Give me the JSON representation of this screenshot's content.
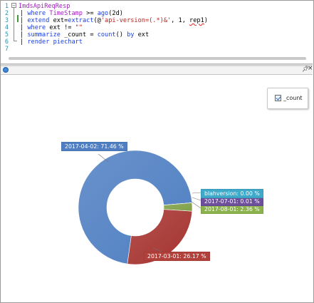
{
  "editor": {
    "lines": [
      {
        "num": "1",
        "segments": [
          {
            "t": "ImdsApiReqResp",
            "c": "purple"
          }
        ]
      },
      {
        "num": "2",
        "segments": [
          {
            "t": "| ",
            "c": "plain"
          },
          {
            "t": "where",
            "c": "blue"
          },
          {
            "t": " TimeStamp ",
            "c": "purple"
          },
          {
            "t": ">= ",
            "c": "plain"
          },
          {
            "t": "ago",
            "c": "blue"
          },
          {
            "t": "(2d)",
            "c": "plain"
          }
        ]
      },
      {
        "num": "3",
        "segments": [
          {
            "t": "| ",
            "c": "plain"
          },
          {
            "t": "extend",
            "c": "blue"
          },
          {
            "t": " ext=",
            "c": "plain"
          },
          {
            "t": "extract",
            "c": "blue"
          },
          {
            "t": "(@",
            "c": "plain"
          },
          {
            "t": "'api-version=(.*)&'",
            "c": "red"
          },
          {
            "t": ", 1, ",
            "c": "plain"
          },
          {
            "t": "rep1",
            "c": "plain",
            "squiggle": true
          },
          {
            "t": ")",
            "c": "plain"
          }
        ]
      },
      {
        "num": "4",
        "segments": [
          {
            "t": "| ",
            "c": "plain"
          },
          {
            "t": "where",
            "c": "blue"
          },
          {
            "t": " ext != ",
            "c": "plain"
          },
          {
            "t": "\"\"",
            "c": "red"
          }
        ]
      },
      {
        "num": "5",
        "segments": [
          {
            "t": "| ",
            "c": "plain"
          },
          {
            "t": "summarize",
            "c": "blue"
          },
          {
            "t": " _count = ",
            "c": "plain"
          },
          {
            "t": "count",
            "c": "blue"
          },
          {
            "t": "() ",
            "c": "plain"
          },
          {
            "t": "by",
            "c": "blue"
          },
          {
            "t": " ext",
            "c": "plain"
          }
        ]
      },
      {
        "num": "6",
        "segments": [
          {
            "t": "| ",
            "c": "plain"
          },
          {
            "t": "render",
            "c": "blue"
          },
          {
            "t": " piechart",
            "c": "blue"
          }
        ]
      },
      {
        "num": "7",
        "segments": []
      }
    ]
  },
  "results_toolbar": {
    "pin_icon": "pin-icon",
    "close_icon": "close-icon"
  },
  "legend": {
    "label": "_count",
    "checked": true
  },
  "chart_data": {
    "type": "pie",
    "donut": true,
    "categories": [
      "2017-04-02",
      "2017-03-01",
      "2017-08-01",
      "2017-07-01",
      "blahversion"
    ],
    "values": [
      71.46,
      26.17,
      2.36,
      0.01,
      0.0
    ],
    "colors": [
      "#4f7fc2",
      "#a5332f",
      "#7fa046",
      "#6d4f9c",
      "#3fa9c9"
    ],
    "labels": [
      "2017-04-02: 71.46 %",
      "2017-03-01: 26.17 %",
      "2017-08-01: 2.36 %",
      "2017-07-01: 0.01 %",
      "blahversion: 0.00 %"
    ],
    "legend_placement": "top-right",
    "series": [
      {
        "name": "_count"
      }
    ]
  }
}
